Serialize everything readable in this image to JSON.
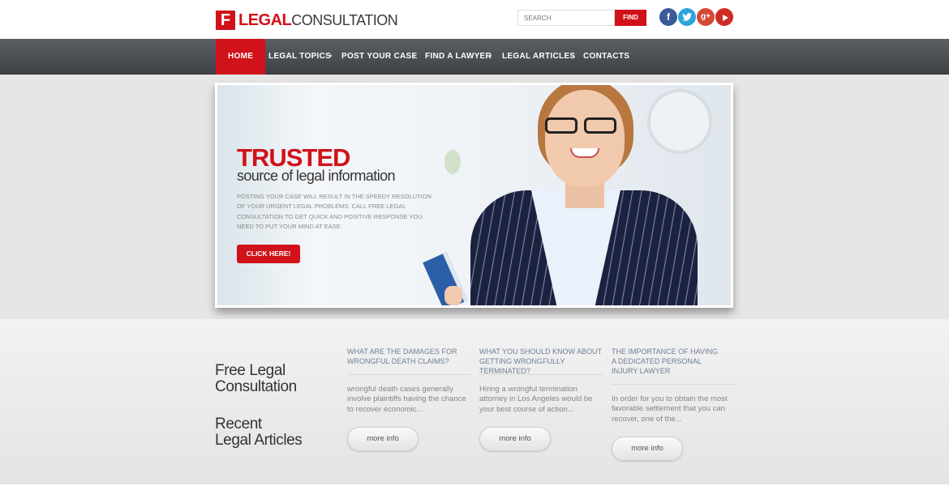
{
  "logo": {
    "letter": "F",
    "part1": "LEGAL",
    "part2": "CONSULTATION"
  },
  "search": {
    "placeholder": "SEARCH",
    "button": "FIND"
  },
  "social": {
    "facebook": "f",
    "twitter": "t",
    "googleplus": "g+"
  },
  "nav": {
    "items": [
      "HOME",
      "LEGAL TOPICS",
      "POST YOUR CASE",
      "FIND A LAWYER",
      "LEGAL ARTICLES",
      "CONTACTS"
    ],
    "separator": "•"
  },
  "hero": {
    "title": "TRUSTED",
    "subtitle": "source of legal information",
    "body": "POSTING YOUR CASE WILL RESULT IN THE SPEEDY RESOLUTION OF YOUR URGENT LEGAL PROBLEMS. CALL FREE LEGAL CONSULTATION TO GET QUICK AND POSITIVE RESPONSE YOU NEED TO PUT YOUR MIND AT EASE.",
    "button": "CLICK HERE!"
  },
  "side": {
    "free_line1": "Free Legal",
    "free_line2": "Consultation",
    "recent_line1": "Recent",
    "recent_line2": "Legal Articles"
  },
  "articles": [
    {
      "title": "WHAT ARE THE DAMAGES FOR WRONGFUL DEATH CLAIMS?",
      "text": "wrongful death cases generally involve plaintiffs having the chance to recover economic...",
      "button": "more info"
    },
    {
      "title": "WHAT YOU SHOULD KNOW ABOUT GETTING WRONGFULLY TERMINATED?",
      "text": "Hiring a wrongful termination attorney in Los Angeles would be your best course of action...",
      "button": "more info"
    },
    {
      "title": "THE IMPORTANCE OF HAVING A DEDICATED PERSONAL INJURY LAWYER",
      "text": "In order for you to obtain the most favorable settlement that you can recover, one of the...",
      "button": "more info"
    }
  ]
}
